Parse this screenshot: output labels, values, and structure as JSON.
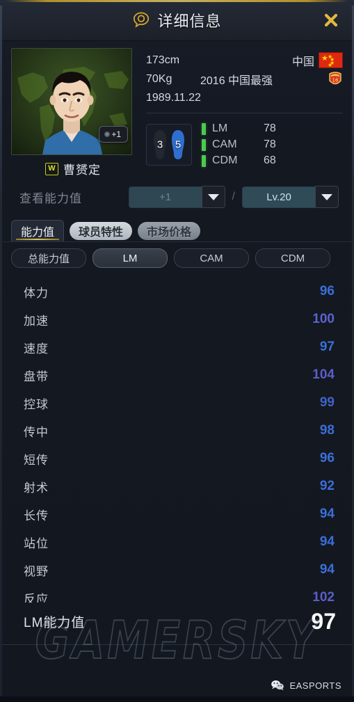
{
  "header": {
    "title": "详细信息",
    "title_icon": "search-bubble-icon",
    "close_icon": "close-icon"
  },
  "player": {
    "name": "曹赟定",
    "name_badge": "W",
    "photo_badge": "+1",
    "height": "173cm",
    "weight": "70Kg",
    "season": "2016 中国最强",
    "birthday": "1989.11.22",
    "nation": "中国",
    "nation_flag": "china-flag-icon",
    "medal_icon": "season-medal-icon",
    "weak_foot": "3",
    "strong_foot": "5",
    "positions": [
      {
        "name": "LM",
        "value": "78"
      },
      {
        "name": "CAM",
        "value": "78"
      },
      {
        "name": "CDM",
        "value": "68"
      }
    ]
  },
  "selector": {
    "label": "查看能力值",
    "boost_value": "+1",
    "separator": "/",
    "level_value": "Lv.20",
    "caret_icon": "chevron-down-icon"
  },
  "tabs": [
    {
      "label": "能力值",
      "active": true
    },
    {
      "label": "球员特性",
      "active": false
    },
    {
      "label": "市场价格",
      "active": false
    }
  ],
  "subtabs": [
    {
      "label": "总能力值",
      "active": false
    },
    {
      "label": "LM",
      "active": true
    },
    {
      "label": "CAM",
      "active": false
    },
    {
      "label": "CDM",
      "active": false
    }
  ],
  "stats": [
    {
      "name": "体力",
      "value": "96",
      "color": "#3a6fd8"
    },
    {
      "name": "加速",
      "value": "100",
      "color": "#5b62cf"
    },
    {
      "name": "速度",
      "value": "97",
      "color": "#3a6fd8"
    },
    {
      "name": "盘带",
      "value": "104",
      "color": "#5b5ec9"
    },
    {
      "name": "控球",
      "value": "99",
      "color": "#3f63c9"
    },
    {
      "name": "传中",
      "value": "98",
      "color": "#3a6fd8"
    },
    {
      "name": "短传",
      "value": "96",
      "color": "#3a6fd8"
    },
    {
      "name": "射术",
      "value": "92",
      "color": "#3a6fd8"
    },
    {
      "name": "长传",
      "value": "94",
      "color": "#3a6fd8"
    },
    {
      "name": "站位",
      "value": "94",
      "color": "#3a6fd8"
    },
    {
      "name": "视野",
      "value": "94",
      "color": "#3a6fd8"
    },
    {
      "name": "反应",
      "value": "102",
      "color": "#5b5ec9"
    }
  ],
  "total": {
    "label": "LM能力值",
    "value": "97"
  },
  "footer": {
    "brand": "EASPORTS",
    "brand_icon": "wechat-icon"
  },
  "watermark": "GAMERSKY",
  "colors": {
    "accent_gold": "#e0c65f",
    "position_bar": "#4ec94e",
    "panel_bg": "#141821"
  }
}
